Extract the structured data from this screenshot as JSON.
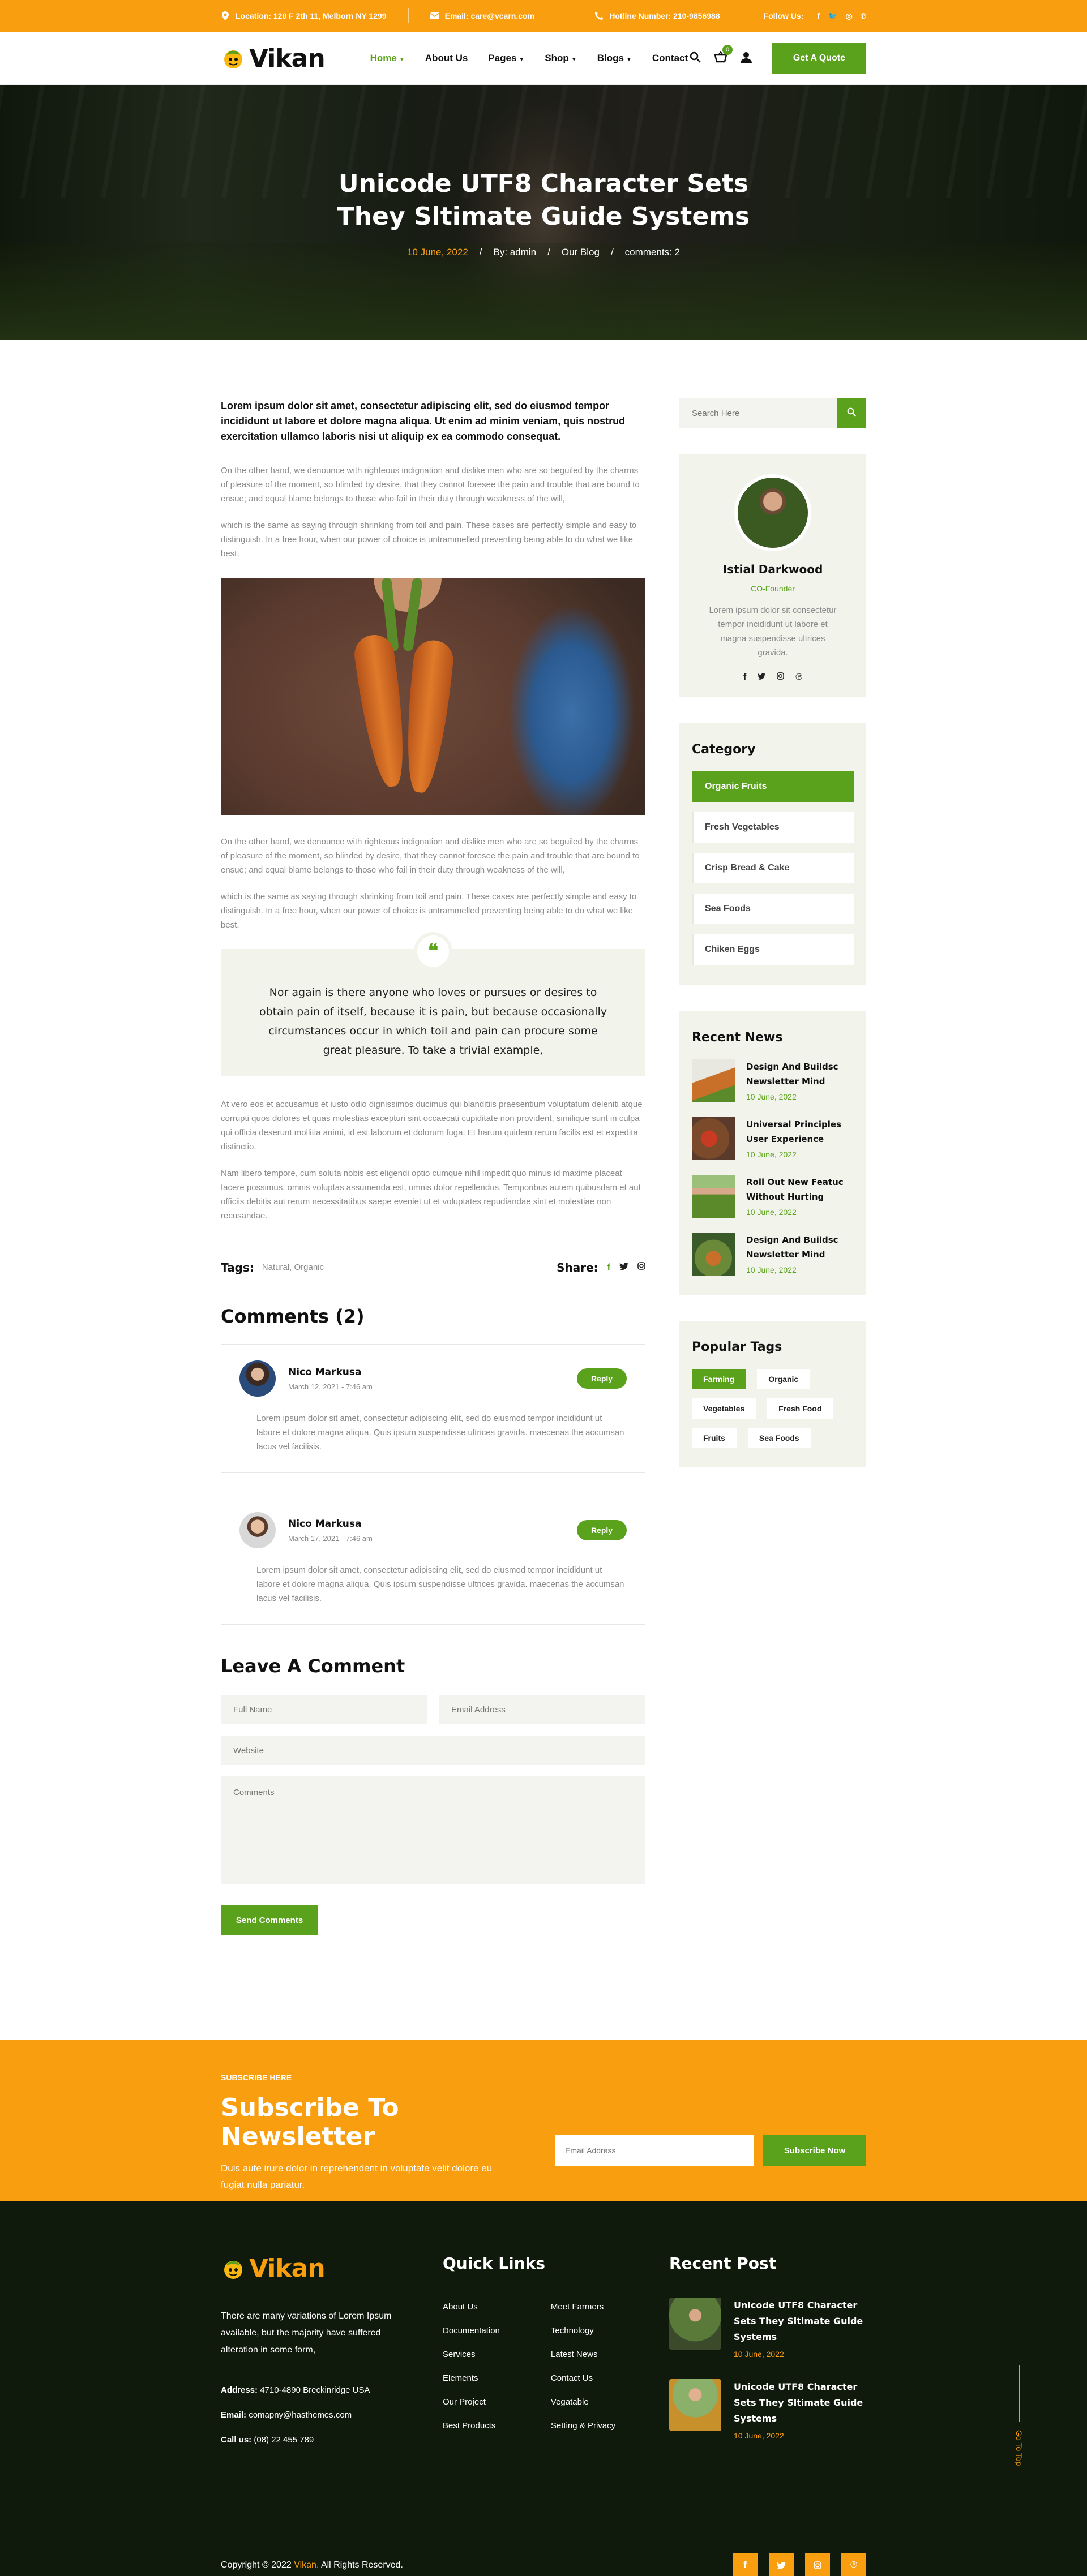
{
  "topbar": {
    "location_label": "Location:",
    "location": "120 F 2th 11, Melborn NY 1299",
    "email_label": "Email:",
    "email": "care@vcarn.com",
    "hotline_label": "Hotline Number:",
    "hotline": "210-9856988",
    "follow_label": "Follow Us:",
    "bg_color": "#f99f0f"
  },
  "header": {
    "logo": "Vikan",
    "nav": [
      "Home",
      "About Us",
      "Pages",
      "Shop",
      "Blogs",
      "Contact"
    ],
    "cart_count": "0",
    "quote_button": "Get A Quote",
    "accent_color": "#5aa21c"
  },
  "hero": {
    "title": "Unicode UTF8 Character Sets They Sltimate Guide Systems",
    "date": "10 June, 2022",
    "author": "By: admin",
    "category": "Our Blog",
    "comments": "comments: 2"
  },
  "post": {
    "lead": "Lorem ipsum dolor sit amet, consectetur adipiscing elit, sed do eiusmod tempor incididunt ut labore et dolore magna aliqua. Ut enim ad minim veniam, quis nostrud exercitation ullamco laboris nisi ut aliquip ex ea commodo consequat.",
    "p1": "On the other hand, we denounce with righteous indignation and dislike men who are so beguiled by the charms of pleasure of the moment, so blinded by desire, that they cannot foresee the pain and trouble that are bound to ensue; and equal blame belongs to those who fail in their duty through weakness of the will,",
    "p2": "which is the same as saying through shrinking from toil and pain. These cases are perfectly simple and easy to distinguish. In a free hour, when our power of choice is untrammelled preventing being able to do what we like best,",
    "p3": "On the other hand, we denounce with righteous indignation and dislike men who are so beguiled by the charms of pleasure of the moment, so blinded by desire, that they cannot foresee the pain and trouble that are bound to ensue; and equal blame belongs to those who fail in their duty through weakness of the will,",
    "p4": "which is the same as saying through shrinking from toil and pain. These cases are perfectly simple and easy to distinguish. In a free hour, when our power of choice is untrammelled preventing being able to do what we like best,",
    "quote": "Nor again is there anyone who loves or pursues or desires to obtain pain of itself, because it is pain, but because occasionally circumstances occur in which toil and pain can procure some great pleasure. To take a trivial example,",
    "p5": "At vero eos et accusamus et iusto odio dignissimos ducimus qui blanditiis praesentium voluptatum deleniti atque corrupti quos dolores et quas molestias excepturi sint occaecati cupiditate non provident, similique sunt in culpa qui officia deserunt mollitia animi, id est laborum et dolorum fuga. Et harum quidem rerum facilis est et expedita distinctio.",
    "p6": "Nam libero tempore, cum soluta nobis est eligendi optio cumque nihil impedit quo minus id maxime placeat facere possimus, omnis voluptas assumenda est, omnis dolor repellendus. Temporibus autem quibusdam et aut officiis debitis aut rerum necessitatibus saepe eveniet ut et voluptates repudiandae sint et molestiae non recusandae.",
    "tags_label": "Tags:",
    "tags": "Natural, Organic",
    "share_label": "Share:"
  },
  "comments": {
    "title": "Comments (2)",
    "items": [
      {
        "name": "Nico Markusa",
        "date": "March 12, 2021 - 7:46 am",
        "text": "Lorem ipsum dolor sit amet, consectetur adipiscing elit, sed do eiusmod tempor incididunt ut labore et dolore magna aliqua. Quis ipsum suspendisse ultrices gravida. maecenas the accumsan lacus vel facilisis.",
        "reply": "Reply"
      },
      {
        "name": "Nico Markusa",
        "date": "March 17, 2021 - 7:46 am",
        "text": "Lorem ipsum dolor sit amet, consectetur adipiscing elit, sed do eiusmod tempor incididunt ut labore et dolore magna aliqua. Quis ipsum suspendisse ultrices gravida. maecenas the accumsan lacus vel facilisis.",
        "reply": "Reply"
      }
    ]
  },
  "form": {
    "title": "Leave A Comment",
    "name_ph": "Full Name",
    "email_ph": "Email Address",
    "website_ph": "Website",
    "comment_ph": "Comments",
    "submit": "Send Comments"
  },
  "sidebar": {
    "search_ph": "Search Here",
    "author": {
      "name": "Istial Darkwood",
      "role": "CO-Founder",
      "bio": "Lorem ipsum dolor sit consectetur tempor incididunt ut labore et magna suspendisse ultrices gravida."
    },
    "category_title": "Category",
    "categories": [
      "Organic Fruits",
      "Fresh Vegetables",
      "Crisp Bread & Cake",
      "Sea Foods",
      "Chiken Eggs"
    ],
    "news_title": "Recent News",
    "news": [
      {
        "title": "Design And Buildsc Newsletter Mind",
        "date": "10 June, 2022"
      },
      {
        "title": "Universal Principles User Experience",
        "date": "10 June, 2022"
      },
      {
        "title": "Roll Out New Featuc Without Hurting",
        "date": "10 June, 2022"
      },
      {
        "title": "Design And Buildsc Newsletter Mind",
        "date": "10 June, 2022"
      }
    ],
    "tags_title": "Popular Tags",
    "tags": [
      "Farming",
      "Organic",
      "Vegetables",
      "Fresh Food",
      "Fruits",
      "Sea Foods"
    ]
  },
  "newsletter": {
    "small": "SUBSCRIBE HERE",
    "title": "Subscribe To Newsletter",
    "desc": "Duis aute irure dolor in reprehenderit in voluptate velit dolore eu fugiat nulla pariatur.",
    "email_ph": "Email Address",
    "button": "Subscribe Now"
  },
  "footer": {
    "logo": "Vikan",
    "desc": "There are many variations of Lorem Ipsum available, but the majority have suffered alteration in some form,",
    "address_label": "Address:",
    "address": "4710-4890 Breckinridge USA",
    "email_label": "Email:",
    "email": "comapny@hasthemes.com",
    "call_label": "Call us:",
    "call": "(08) 22 455 789",
    "links_title": "Quick Links",
    "links_col1": [
      "About Us",
      "Documentation",
      "Services",
      "Elements",
      "Our Project",
      "Best Products"
    ],
    "links_col2": [
      "Meet Farmers",
      "Technology",
      "Latest News",
      "Contact Us",
      "Vegatable",
      "Setting & Privacy"
    ],
    "posts_title": "Recent Post",
    "posts": [
      {
        "title": "Unicode UTF8 Character Sets They Sltimate Guide Systems",
        "date": "10 June, 2022"
      },
      {
        "title": "Unicode UTF8 Character Sets They Sltimate Guide Systems",
        "date": "10 June, 2022"
      }
    ],
    "go_top": "Go To Top",
    "copyright_prefix": "Copyright © 2022",
    "copyright_brand": "Vikan.",
    "copyright_suffix": "All Rights Reserved."
  }
}
